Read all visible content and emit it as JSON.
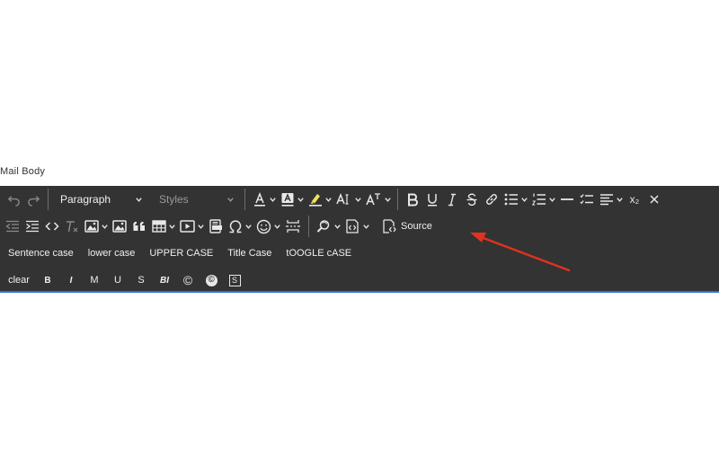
{
  "field_label": "Mail Body",
  "toolbar": {
    "paragraph_label": "Paragraph",
    "styles_label": "Styles",
    "source_label": "Source",
    "subscript_label": "x₂"
  },
  "case_buttons": [
    "Sentence case",
    "lower case",
    "UPPER CASE",
    "Title Case",
    "tOOGLE cASE"
  ],
  "format_buttons": [
    "clear",
    "B",
    "I",
    "M",
    "U",
    "S",
    "BI",
    "©",
    "©",
    "S"
  ],
  "colors": {
    "toolbar_bg": "#333333",
    "icon": "#e8e8e8",
    "focus_border": "#2f6fdd",
    "annotation_arrow": "#e0321e",
    "highlight_pen": "#f2e05a"
  }
}
